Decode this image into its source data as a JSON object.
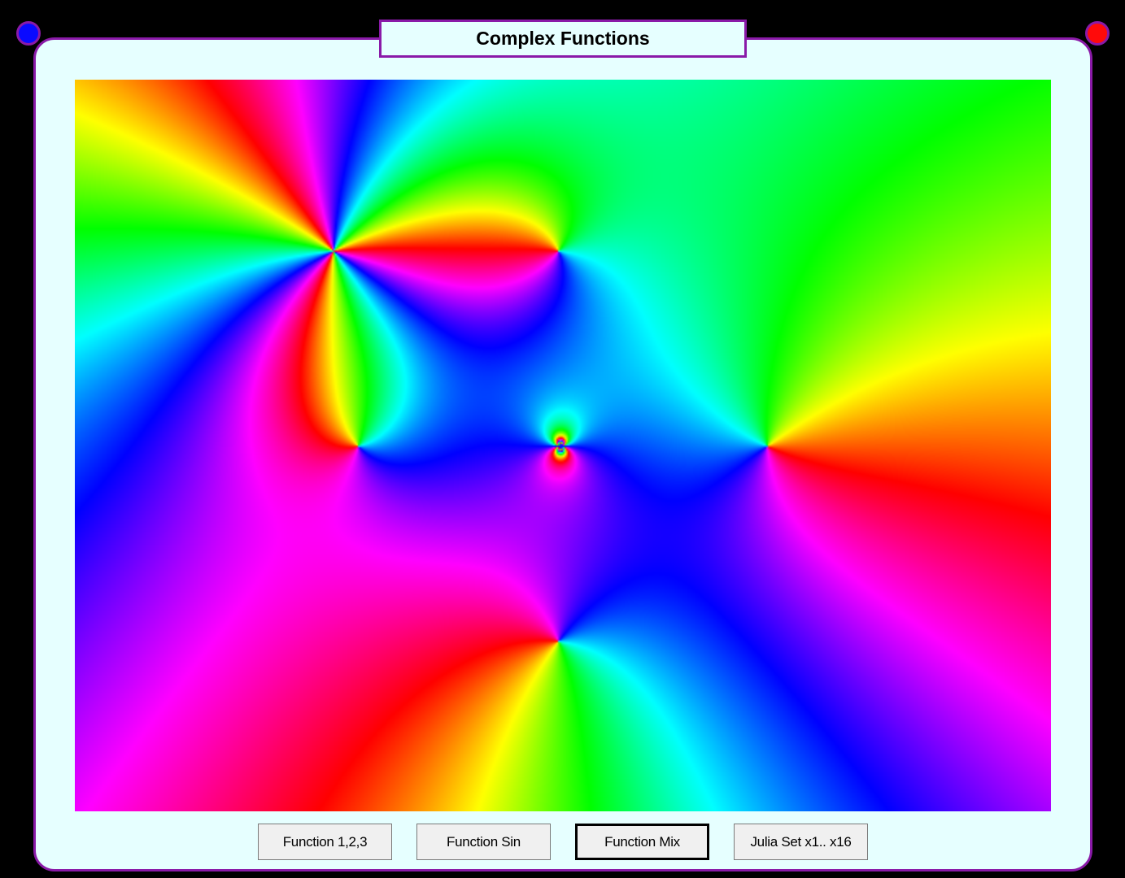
{
  "window": {
    "title": "Complex Functions"
  },
  "plot": {
    "description_colors": {
      "frame": "#8a1aa8",
      "background": "#e6ffff",
      "left_dot": "#0a0aff",
      "right_dot": "#ff0a0a"
    }
  },
  "buttons": [
    {
      "label": "Function 1,2,3",
      "active": false
    },
    {
      "label": "Function Sin",
      "active": false
    },
    {
      "label": "Function Mix",
      "active": true
    },
    {
      "label": "Julia Set x1.. x16",
      "active": false
    }
  ]
}
